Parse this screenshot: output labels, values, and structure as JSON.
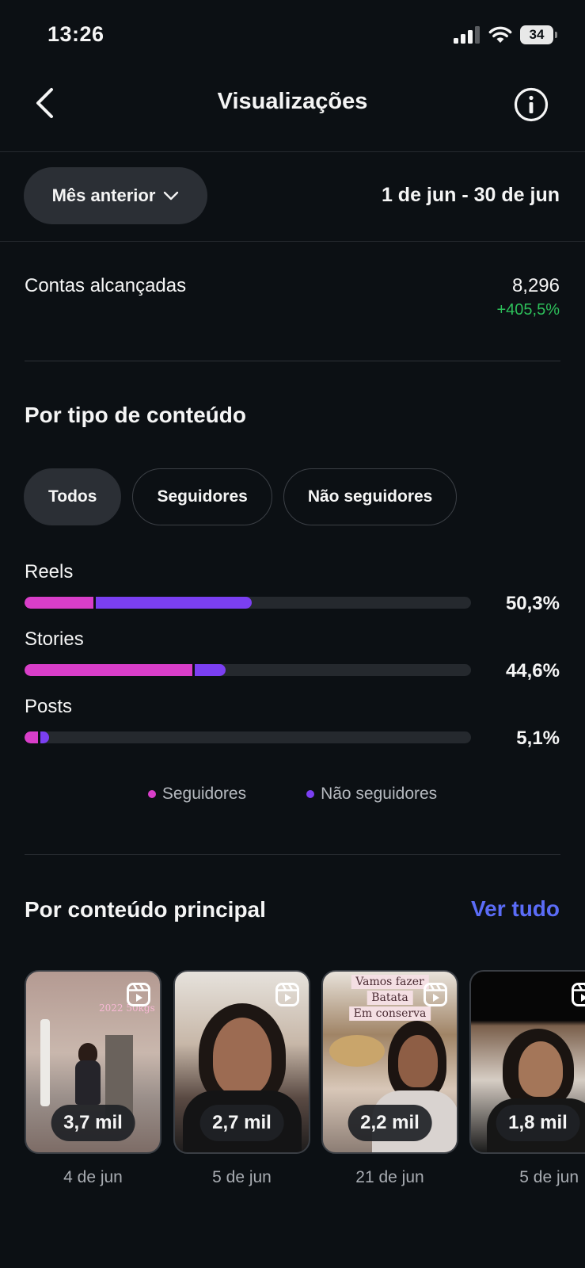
{
  "status_bar": {
    "time": "13:26",
    "battery": "34"
  },
  "header": {
    "title": "Visualizações"
  },
  "filter": {
    "period_label": "Mês anterior",
    "date_range": "1 de jun - 30 de jun"
  },
  "reach": {
    "label": "Contas alcançadas",
    "value": "8,296",
    "change": "+405,5%"
  },
  "content_type": {
    "title": "Por tipo de conteúdo",
    "tabs": [
      {
        "label": "Todos",
        "active": true
      },
      {
        "label": "Seguidores",
        "active": false
      },
      {
        "label": "Não seguidores",
        "active": false
      }
    ],
    "rows": [
      {
        "label": "Reels",
        "percent": "50,3%",
        "followers_fraction": 0.155,
        "non_followers_fraction": 0.35
      },
      {
        "label": "Stories",
        "percent": "44,6%",
        "followers_fraction": 0.375,
        "non_followers_fraction": 0.07
      },
      {
        "label": "Posts",
        "percent": "5,1%",
        "followers_fraction": 0.03,
        "non_followers_fraction": 0.02
      }
    ],
    "legend": {
      "followers": "Seguidores",
      "non_followers": "Não seguidores"
    },
    "colors": {
      "followers": "#d93ec9",
      "non_followers": "#7b3ff2",
      "positive_change": "#2dbf5a"
    }
  },
  "top_content": {
    "title": "Por conteúdo principal",
    "see_all": "Ver tudo",
    "items": [
      {
        "views": "3,7 mil",
        "date": "4 de jun",
        "type_icon": "reels-icon",
        "overlay": "2022 50kgs"
      },
      {
        "views": "2,7 mil",
        "date": "5 de jun",
        "type_icon": "reels-icon"
      },
      {
        "views": "2,2 mil",
        "date": "21 de jun",
        "type_icon": "reels-icon",
        "overlay_lines": [
          "Vamos fazer",
          "Batata",
          "Em conserva"
        ]
      },
      {
        "views": "1,8 mil",
        "date": "5 de jun",
        "type_icon": "reels-icon"
      }
    ]
  }
}
